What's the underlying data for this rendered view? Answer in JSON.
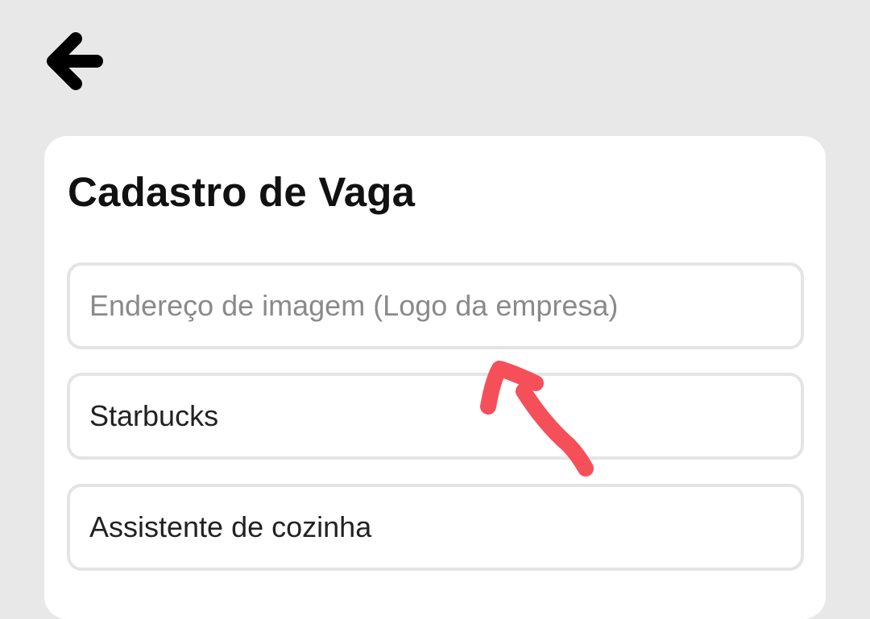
{
  "header": {
    "back_icon": "arrow-left-icon"
  },
  "form": {
    "title": "Cadastro de Vaga",
    "fields": [
      {
        "placeholder": "Endereço de imagem (Logo da empresa)",
        "value": ""
      },
      {
        "placeholder": "",
        "value": "Starbucks"
      },
      {
        "placeholder": "",
        "value": "Assistente de cozinha"
      }
    ]
  },
  "colors": {
    "background": "#e8e8e8",
    "card": "#ffffff",
    "field_border": "#e4e4e4",
    "annotation_arrow": "#f5505a"
  },
  "annotation": {
    "icon": "red-arrow-annotation"
  }
}
